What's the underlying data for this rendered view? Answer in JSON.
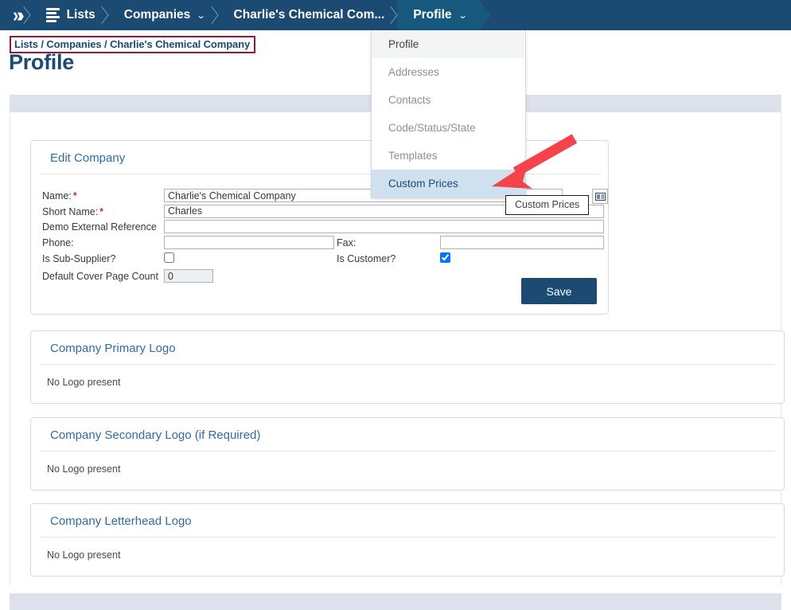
{
  "topnav": {
    "home_icon": "chevrons-right-icon",
    "items": [
      {
        "label": "Lists",
        "icon": "hamburger-menu-icon",
        "caret": false,
        "active": false
      },
      {
        "label": "Companies",
        "caret": true,
        "active": false
      },
      {
        "label": "Charlie's Chemical Com...",
        "caret": false,
        "active": false
      },
      {
        "label": "Profile",
        "caret": true,
        "active": true
      }
    ],
    "caret_glyph": "⌄"
  },
  "breadcrumb": {
    "text": "Lists / Companies / Charlie's Chemical Company",
    "highlight_color": "#8c1b3f"
  },
  "page": {
    "title": "Profile"
  },
  "dropdown": {
    "items": [
      {
        "label": "Profile",
        "state": "first"
      },
      {
        "label": "Addresses",
        "state": "normal"
      },
      {
        "label": "Contacts",
        "state": "normal"
      },
      {
        "label": "Code/Status/State",
        "state": "normal"
      },
      {
        "label": "Templates",
        "state": "normal"
      },
      {
        "label": "Custom Prices",
        "state": "highlight"
      }
    ]
  },
  "tooltip": {
    "text": "Custom Prices"
  },
  "edit_company": {
    "title": "Edit Company",
    "fields": {
      "name_label": "Name:",
      "name_value": "Charlie's Chemical Company",
      "short_name_label": "Short Name:",
      "short_name_value": "Charles",
      "demo_ref_label": "Demo External Reference",
      "demo_ref_value": "",
      "phone_label": "Phone:",
      "phone_value": "",
      "fax_label": "Fax:",
      "fax_value": "",
      "is_sub_supplier_label": "Is Sub-Supplier?",
      "is_customer_label": "Is Customer?",
      "cover_page_label": "Default Cover Page Count",
      "cover_page_value": "0"
    },
    "required_marker": "*",
    "contact_picker_icon": "contact-card-icon",
    "save_label": "Save"
  },
  "logo_cards": [
    {
      "title": "Company Primary Logo",
      "body": "No Logo present"
    },
    {
      "title": "Company Secondary Logo (if Required)",
      "body": "No Logo present"
    },
    {
      "title": "Company Letterhead Logo",
      "body": "No Logo present"
    }
  ],
  "colors": {
    "nav_bg": "#1b4a72",
    "nav_active": "#17597e",
    "band": "#dce1ec",
    "accent_text": "#2f6ca0",
    "annotation_arrow": "#f4434a",
    "menu_highlight": "#cfe0ef"
  }
}
